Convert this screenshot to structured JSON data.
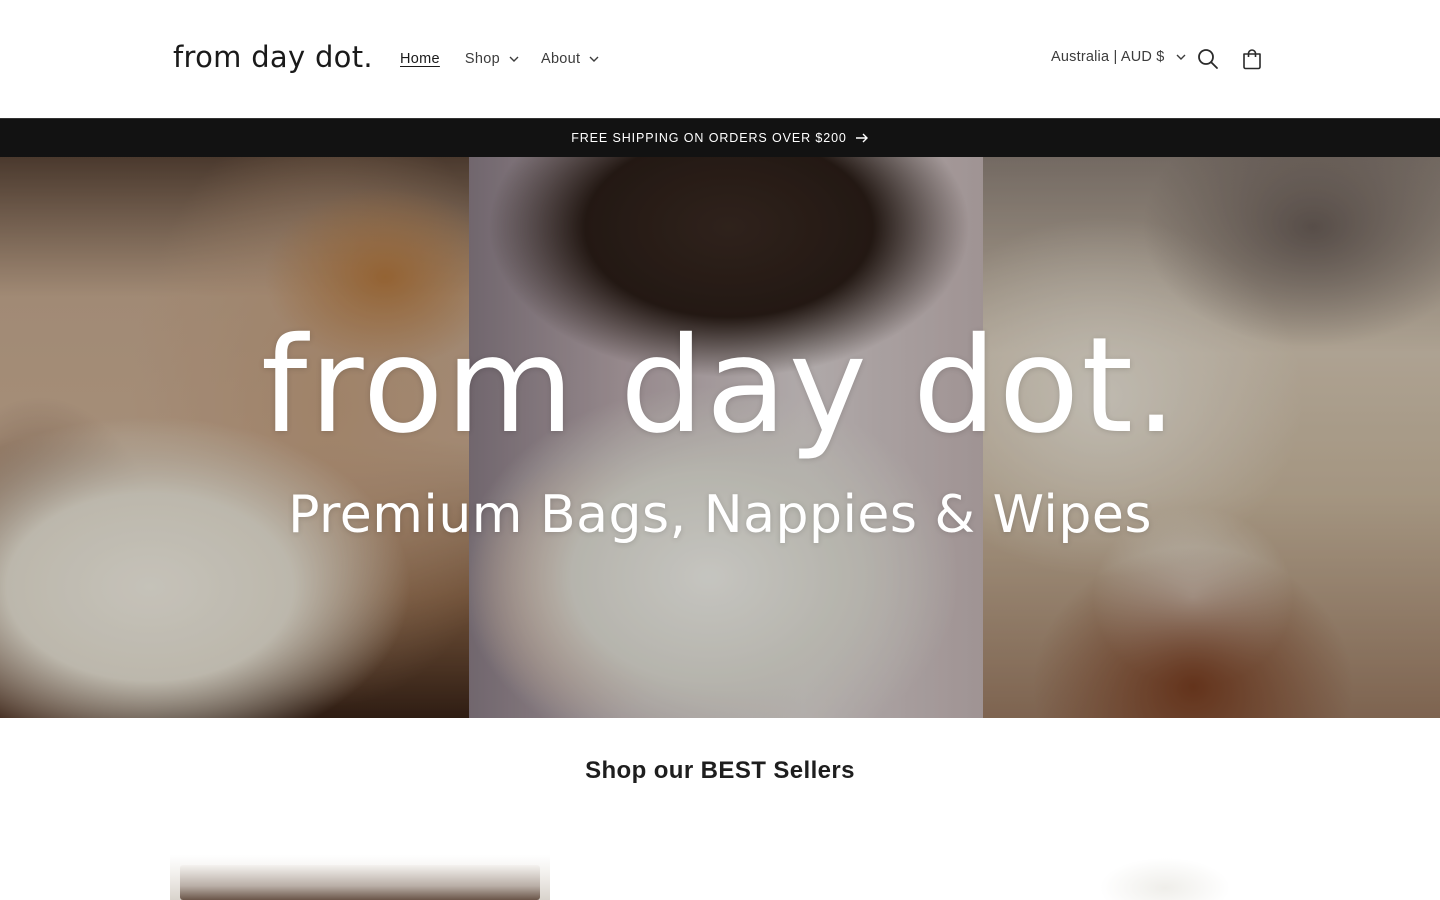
{
  "header": {
    "logo": "from day dot.",
    "nav": {
      "home": "Home",
      "shop": "Shop",
      "about": "About"
    },
    "locale": "Australia | AUD $",
    "icons": {
      "search": "search-icon",
      "cart": "cart-icon"
    }
  },
  "announcement": {
    "text": "FREE SHIPPING ON ORDERS OVER $200"
  },
  "hero": {
    "title": "from day dot.",
    "subtitle": "Premium Bags, Nappies & Wipes"
  },
  "best_sellers": {
    "title": "Shop our BEST Sellers"
  },
  "colors": {
    "announcement_bg": "#121212",
    "text": "#121212",
    "background": "#ffffff"
  }
}
